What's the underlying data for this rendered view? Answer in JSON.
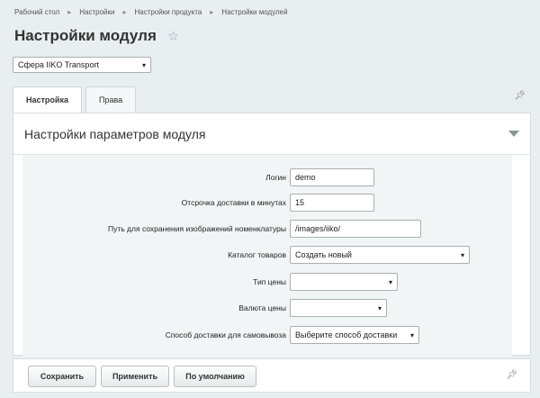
{
  "breadcrumb": [
    "Рабочий стол",
    "Настройки",
    "Настройки продукта",
    "Настройки модулей"
  ],
  "page_title": "Настройки модуля",
  "site_select": "Сфера IIKO Transport",
  "tabs": [
    {
      "label": "Настройка",
      "active": true
    },
    {
      "label": "Права",
      "active": false
    }
  ],
  "panel_title": "Настройки параметров модуля",
  "form": {
    "login": {
      "label": "Логин",
      "value": "demo"
    },
    "delay": {
      "label": "Отсрочка доставки в минутах",
      "value": "15"
    },
    "path": {
      "label": "Путь для сохранения изображений номенклатуры",
      "value": "/images/iiko/"
    },
    "catalog": {
      "label": "Каталог товаров",
      "value": "Создать новый"
    },
    "price_type": {
      "label": "Тип цены",
      "value": ""
    },
    "currency": {
      "label": "Валюта цены",
      "value": ""
    },
    "pickup": {
      "label": "Способ доставки для самовывоза",
      "value": "Выберите способ доставки"
    }
  },
  "buttons": {
    "save": "Сохранить",
    "apply": "Применить",
    "default": "По умолчанию"
  },
  "icons": {
    "star": "star-icon",
    "pin": "pin-icon",
    "chevron": "chevron-down-icon",
    "collapse": "collapse-triangle-icon"
  }
}
